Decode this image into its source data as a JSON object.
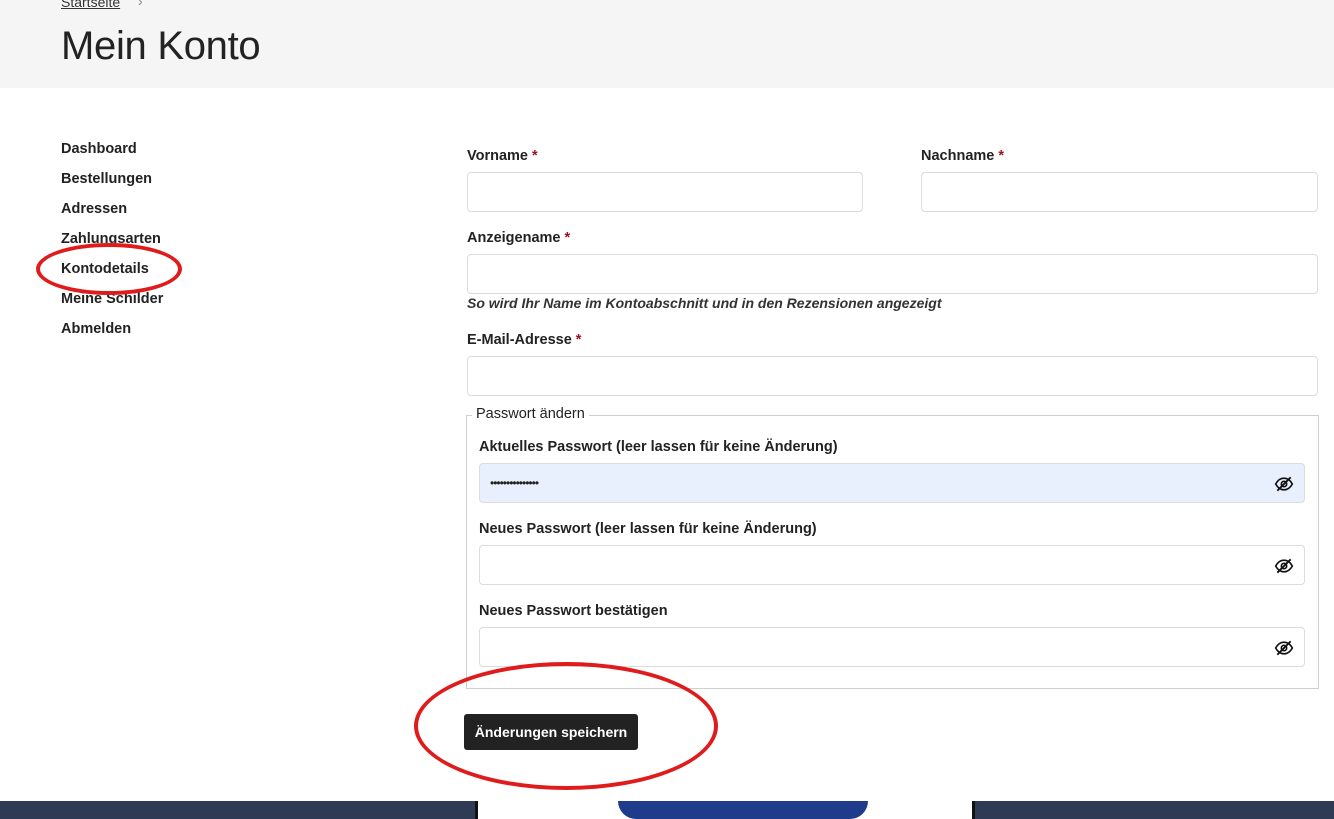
{
  "breadcrumb": {
    "home": "Startseite",
    "separator": "›"
  },
  "page": {
    "title": "Mein Konto"
  },
  "nav": {
    "items": [
      {
        "label": "Dashboard"
      },
      {
        "label": "Bestellungen"
      },
      {
        "label": "Adressen"
      },
      {
        "label": "Zahlungsarten"
      },
      {
        "label": "Kontodetails",
        "active": true
      },
      {
        "label": "Meine Schilder"
      },
      {
        "label": "Abmelden"
      }
    ]
  },
  "form": {
    "required_marker": "*",
    "first_name": {
      "label": "Vorname",
      "value": ""
    },
    "last_name": {
      "label": "Nachname",
      "value": ""
    },
    "display_name": {
      "label": "Anzeigename",
      "value": "",
      "hint": "So wird Ihr Name im Kontoabschnitt und in den Rezensionen angezeigt"
    },
    "email": {
      "label": "E-Mail-Adresse",
      "value": ""
    },
    "password_section": {
      "legend": "Passwort ändern",
      "current": {
        "label": "Aktuelles Passwort (leer lassen für keine Änderung)",
        "value": "•••••••••••••••"
      },
      "new": {
        "label": "Neues Passwort (leer lassen für keine Änderung)",
        "value": ""
      },
      "confirm": {
        "label": "Neues Passwort bestätigen",
        "value": ""
      }
    },
    "save_label": "Änderungen speichern"
  },
  "icons": {
    "password_toggle": "eye-slash-icon"
  },
  "annotation": {
    "color": "#e01b1b"
  }
}
